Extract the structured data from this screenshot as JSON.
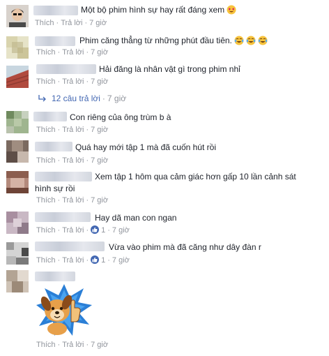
{
  "labels": {
    "like": "Thích",
    "reply": "Trả lời",
    "separator": "·"
  },
  "comments": [
    {
      "text": "Một bộ phim hình sự hay rất đáng xem",
      "emoji": "heart-eyes-emoji",
      "time": "7 giờ"
    },
    {
      "text": "Phim căng thẳng từ những phút đầu tiên.",
      "emoji": "tears-of-joy-emoji",
      "time": "7 giờ"
    },
    {
      "text": "Hải đăng là nhân vật gì trong phim nhỉ",
      "time": "7 giờ"
    },
    {
      "text": "Con riêng của ông trùm b à",
      "time": "7 giờ"
    },
    {
      "text": "Quá hay mới tập 1 mà đã cuốn hút rồi",
      "time": "7 giờ"
    },
    {
      "text": "Xem tập 1 hôm qua cảm giác hơn gấp 10 lần cảnh sát hình sự rồi",
      "time": "7 giờ"
    },
    {
      "text": "Hay dã man con ngan",
      "likes": "1",
      "time": "7 giờ"
    },
    {
      "text": "Vừa vào phim mà đã căng như dây đàn r",
      "likes": "1",
      "time": "7 giờ"
    },
    {
      "sticker": "dog-thumbs-up-sticker",
      "time": "7 giờ"
    }
  ],
  "replies": {
    "label": "12 câu trả lời",
    "time": "7 giờ"
  },
  "colors": {
    "link": "#4267b2",
    "meta": "#90949c",
    "text": "#1d2129",
    "like_badge": "#4267b2"
  }
}
